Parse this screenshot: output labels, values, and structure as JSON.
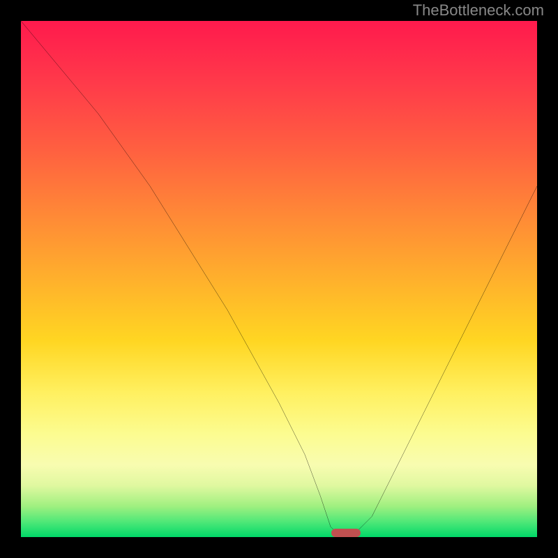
{
  "watermark": "TheBottleneck.com",
  "chart_data": {
    "type": "line",
    "title": "",
    "xlabel": "",
    "ylabel": "",
    "xlim": [
      0,
      100
    ],
    "ylim": [
      0,
      100
    ],
    "grid": false,
    "legend": false,
    "background": {
      "type": "vertical-gradient",
      "stops": [
        {
          "pos": 0,
          "color": "#ff1a4d"
        },
        {
          "pos": 25,
          "color": "#ff6040"
        },
        {
          "pos": 50,
          "color": "#ffb02c"
        },
        {
          "pos": 72,
          "color": "#fff060"
        },
        {
          "pos": 86,
          "color": "#f8fcb0"
        },
        {
          "pos": 94,
          "color": "#a0f080"
        },
        {
          "pos": 100,
          "color": "#00d868"
        }
      ]
    },
    "series": [
      {
        "name": "bottleneck-curve",
        "color": "#000000",
        "x": [
          0,
          5,
          10,
          15,
          20,
          25,
          30,
          35,
          40,
          45,
          50,
          55,
          58,
          60,
          62,
          64,
          68,
          72,
          78,
          85,
          92,
          100
        ],
        "y": [
          100,
          94,
          88,
          82,
          75,
          68,
          60,
          52,
          44,
          35,
          26,
          16,
          8,
          2,
          0,
          0,
          4,
          12,
          24,
          38,
          52,
          68
        ]
      }
    ],
    "marker": {
      "name": "optimal-point",
      "x": 63,
      "y": 0,
      "color": "#c05050",
      "shape": "pill"
    }
  }
}
